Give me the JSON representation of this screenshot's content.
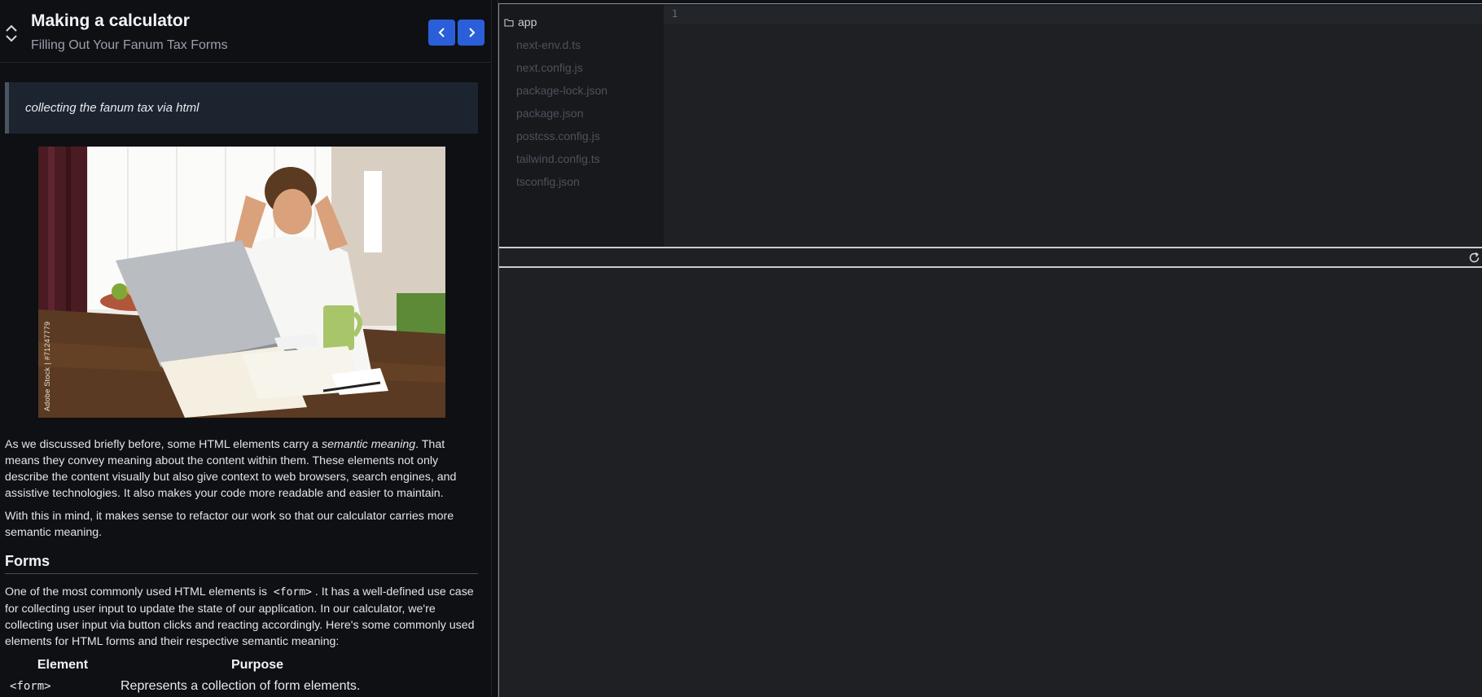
{
  "lesson": {
    "title": "Making a calculator",
    "subtitle": "Filling Out Your Fanum Tax Forms",
    "callout": "collecting the fanum tax via html",
    "image_credit": "Adobe Stock | #71247779",
    "para1": {
      "a": "As we discussed briefly before, some HTML elements carry a ",
      "em": "semantic meaning",
      "b": ". That means they convey meaning about the content within them. These elements not only describe the content visually but also give context to web browsers, search engines, and assistive technologies. It also makes your code more readable and easier to maintain."
    },
    "para2": "With this in mind, it makes sense to refactor our work so that our calculator carries more semantic meaning.",
    "forms_heading": "Forms",
    "para3": {
      "a": "One of the most commonly used HTML elements is ",
      "code": "<form>",
      "b": ". It has a well-defined use case for collecting user input to update the state of our application. In our calculator, we're collecting user input via button clicks and reacting accordingly. Here's some commonly used elements for HTML forms and their respective semantic meaning:"
    },
    "table": {
      "headers": [
        "Element",
        "Purpose"
      ],
      "rows": [
        {
          "element": "<form>",
          "purpose": "Represents a collection of form elements."
        }
      ]
    }
  },
  "workspace": {
    "folder": "app",
    "files": [
      "next-env.d.ts",
      "next.config.js",
      "package-lock.json",
      "package.json",
      "postcss.config.js",
      "tailwind.config.ts",
      "tsconfig.json"
    ],
    "line_number": "1"
  },
  "colors": {
    "accent": "#2b5fd9",
    "panel_bg": "#0e1014",
    "editor_bg": "#1e2024",
    "callout_bg": "#1c2430"
  }
}
